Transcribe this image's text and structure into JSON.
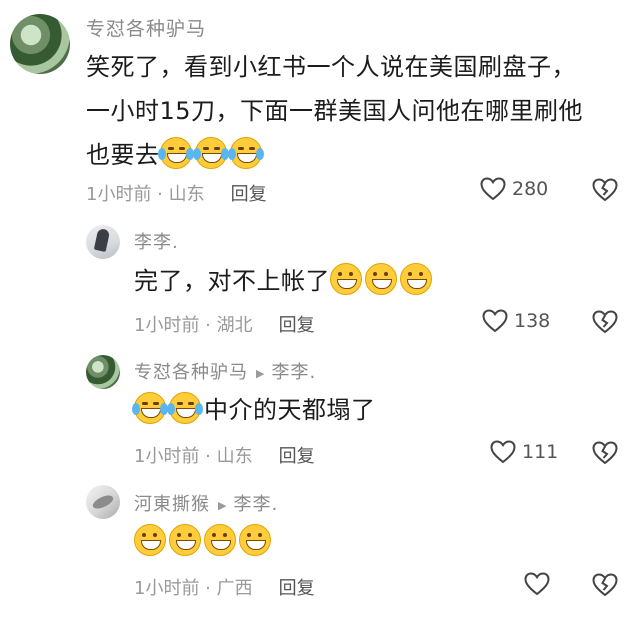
{
  "comments": [
    {
      "author": "专怼各种驴马",
      "text_lines": [
        "笑死了，看到小红书一个人说在美国刷盘子，",
        "一小时15刀，下面一群美国人问他在哪里刷他",
        "也要去"
      ],
      "emoji": [
        "laugh-cry-emoji",
        "laugh-cry-emoji",
        "laugh-cry-emoji"
      ],
      "time_location": "1小时前 · 山东",
      "reply_label": "回复",
      "likes": "280"
    },
    {
      "author": "李李.",
      "text": "完了，对不上帐了",
      "emoji": [
        "grin-emoji",
        "grin-emoji",
        "grin-emoji"
      ],
      "time_location": "1小时前 · 湖北",
      "reply_label": "回复",
      "likes": "138"
    },
    {
      "author": "专怼各种驴马",
      "reply_to": "李李.",
      "text": "中介的天都塌了",
      "emoji": [
        "laugh-cry-emoji",
        "laugh-cry-emoji"
      ],
      "time_location": "1小时前 · 山东",
      "reply_label": "回复",
      "likes": "111"
    },
    {
      "author": "河東撕猴",
      "reply_to": "李李.",
      "text": "",
      "emoji": [
        "grin-emoji",
        "grin-emoji",
        "grin-emoji",
        "grin-emoji"
      ],
      "time_location": "1小时前 · 广西",
      "reply_label": "回复",
      "likes": ""
    }
  ],
  "icons": {
    "like": "heart-outline-icon",
    "dislike": "broken-heart-icon"
  },
  "colors": {
    "name": "#8a8a8a",
    "meta": "#9a9a9a",
    "text": "#1c1c1c",
    "emoji": "#ffcd3c"
  }
}
